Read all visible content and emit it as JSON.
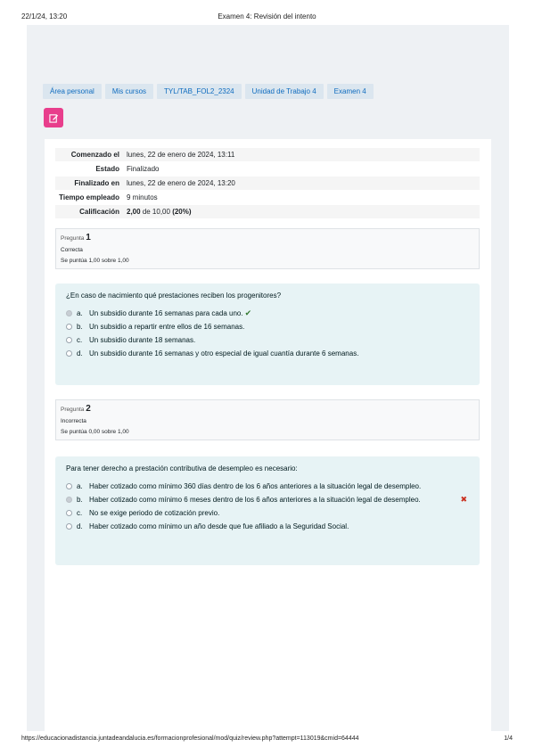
{
  "print_header": {
    "date": "22/1/24, 13:20",
    "title": "Examen 4: Revisión del intento"
  },
  "print_footer": {
    "url": "https://educacionadistancia.juntadeandalucia.es/formacionprofesional/mod/quiz/review.php?attempt=113019&cmid=64444",
    "page": "1/4"
  },
  "breadcrumb": [
    "Área personal",
    "Mis cursos",
    "TYL/TAB_FOL2_2324",
    "Unidad de Trabajo 4",
    "Examen 4"
  ],
  "colors": {
    "accent": "#e83e8c",
    "link": "#0f6cbf",
    "question_bg": "#e7f3f5",
    "correct": "#357a32",
    "incorrect": "#ca3120"
  },
  "summary": {
    "rows": [
      {
        "label": "Comenzado el",
        "value": "lunes, 22 de enero de 2024, 13:11"
      },
      {
        "label": "Estado",
        "value": "Finalizado"
      },
      {
        "label": "Finalizado en",
        "value": "lunes, 22 de enero de 2024, 13:20"
      },
      {
        "label": "Tiempo empleado",
        "value": "9 minutos"
      }
    ],
    "grade": {
      "label": "Calificación",
      "score": "2,00",
      "suffix": "de 10,00",
      "percent": "(20%)"
    }
  },
  "questions": [
    {
      "prefix": "Pregunta",
      "number": "1",
      "state": "Correcta",
      "mark": "Se puntúa 1,00 sobre 1,00",
      "text": "¿En caso de nacimiento qué prestaciones reciben los progenitores?",
      "answers": [
        {
          "letter": "a.",
          "text": "Un subsidio durante 16 semanas para cada uno."
        },
        {
          "letter": "b.",
          "text": "Un subsidio a repartir entre ellos de 16 semanas."
        },
        {
          "letter": "c.",
          "text": "Un subsidio durante 18 semanas."
        },
        {
          "letter": "d.",
          "text": "Un subsidio durante 16 semanas y otro especial de igual cuantía durante 6 semanas."
        }
      ]
    },
    {
      "prefix": "Pregunta",
      "number": "2",
      "state": "Incorrecta",
      "mark": "Se puntúa 0,00 sobre 1,00",
      "text": "Para tener derecho a prestación contributiva de desempleo es necesario:",
      "answers": [
        {
          "letter": "a.",
          "text": "Haber cotizado como mínimo 360 días dentro de los 6 años anteriores a la situación legal de desempleo."
        },
        {
          "letter": "b.",
          "text": "Haber cotizado como mínimo 6 meses dentro de los 6 años anteriores a la situación legal de desempleo."
        },
        {
          "letter": "c.",
          "text": "No se exige periodo de cotización previo."
        },
        {
          "letter": "d.",
          "text": "Haber cotizado como mínimo un año desde que fue afiliado a la Seguridad Social."
        }
      ]
    }
  ]
}
